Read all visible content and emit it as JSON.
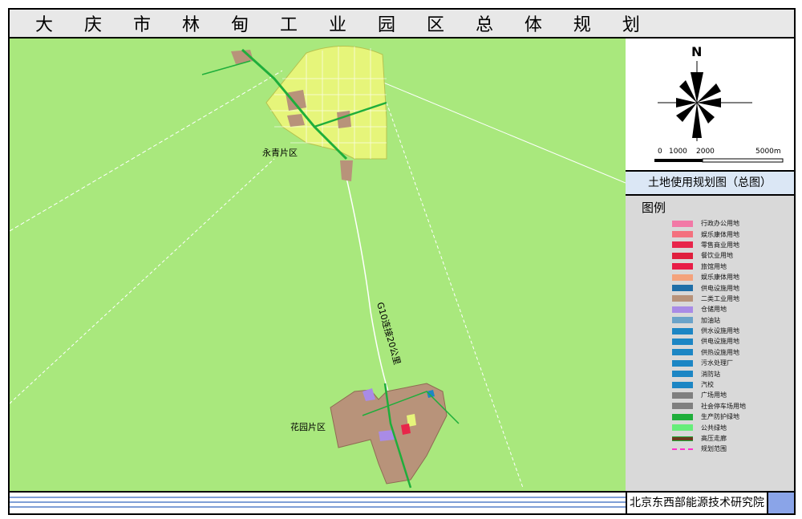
{
  "title": "大 庆 市 林 甸 工 业 园 区 总 体 规 划",
  "map": {
    "labels": {
      "north_district": "永青片区",
      "south_district": "花园片区",
      "road": "G10连接20公里"
    },
    "colors": {
      "background": "#a9e87d",
      "town": "#e6f57a",
      "industrial": "#b8937a",
      "green_belt": "#1fae3b",
      "road": "#ffffff"
    }
  },
  "compass": {
    "north_label": "N",
    "scale_labels": [
      "0",
      "1000",
      "2000",
      "5000m"
    ]
  },
  "plan_title": "土地使用规划图（总图）",
  "legend": {
    "title": "图例",
    "items": [
      {
        "label": "行政办公用地",
        "color": "#f279a6",
        "kind": "box"
      },
      {
        "label": "娱乐康体用地",
        "color": "#f4717e",
        "kind": "box"
      },
      {
        "label": "零售商业用地",
        "color": "#e8254a",
        "kind": "box"
      },
      {
        "label": "餐饮业用地",
        "color": "#e01f3d",
        "kind": "box"
      },
      {
        "label": "旅馆用地",
        "color": "#e81d47",
        "kind": "box"
      },
      {
        "label": "娱乐康体用地",
        "color": "#f4a37c",
        "kind": "box"
      },
      {
        "label": "供电设施用地",
        "color": "#1f6fa8",
        "kind": "box"
      },
      {
        "label": "二类工业用地",
        "color": "#b8937a",
        "kind": "box"
      },
      {
        "label": "仓储用地",
        "color": "#a98be6",
        "kind": "box"
      },
      {
        "label": "加油站",
        "color": "#6aa3c9",
        "kind": "box"
      },
      {
        "label": "供水设施用地",
        "color": "#1c86c4",
        "kind": "box"
      },
      {
        "label": "供电设施用地",
        "color": "#1c86c4",
        "kind": "box"
      },
      {
        "label": "供热设施用地",
        "color": "#1c86c4",
        "kind": "box"
      },
      {
        "label": "污水处理厂",
        "color": "#1c86c4",
        "kind": "box"
      },
      {
        "label": "消防站",
        "color": "#1c86c4",
        "kind": "box"
      },
      {
        "label": "汽校",
        "color": "#1c86c4",
        "kind": "box"
      },
      {
        "label": "广场用地",
        "color": "#7f7f7f",
        "kind": "box"
      },
      {
        "label": "社会停车场用地",
        "color": "#7f7f7f",
        "kind": "box"
      },
      {
        "label": "生产防护绿地",
        "color": "#1fae3b",
        "kind": "box"
      },
      {
        "label": "公共绿地",
        "color": "#66ee7a",
        "kind": "box"
      },
      {
        "label": "高压走廊",
        "color": "#6b3a1e",
        "kind": "line"
      },
      {
        "label": "规划范围",
        "color": "#ff33cc",
        "kind": "dash"
      }
    ]
  },
  "footer": {
    "organization": "北京东西部能源技术研究院"
  }
}
